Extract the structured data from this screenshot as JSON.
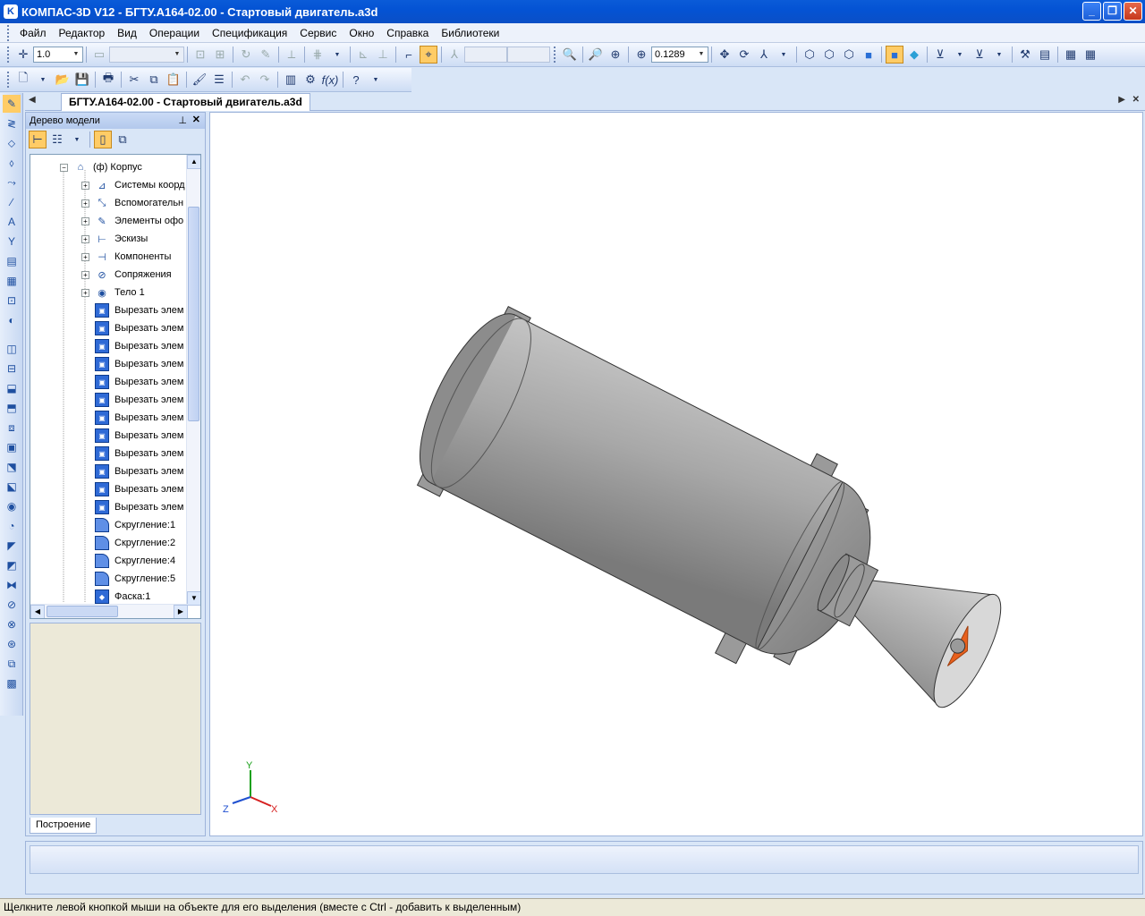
{
  "app": {
    "title": "КОМПАС-3D V12 - БГТУ.А164-02.00 - Стартовый двигатель.a3d",
    "logo": "K",
    "window_buttons": {
      "minimize": "_",
      "maximize": "❐",
      "close": "✕"
    }
  },
  "menu": [
    "Файл",
    "Редактор",
    "Вид",
    "Операции",
    "Спецификация",
    "Сервис",
    "Окно",
    "Справка",
    "Библиотеки"
  ],
  "toolbar": {
    "step_value": "1.0",
    "zoom_value": "0.1289"
  },
  "doc_tab": {
    "title": "БГТУ.А164-02.00 - Стартовый двигатель.a3d"
  },
  "tree_panel": {
    "title": "Дерево модели",
    "bottom_tab": "Построение",
    "items": [
      {
        "label": "(ф) Корпус",
        "icon": "part-icon",
        "level": 0,
        "expander": "−"
      },
      {
        "label": "Системы коорд",
        "icon": "coordinate-system-icon",
        "level": 1,
        "expander": "+"
      },
      {
        "label": "Вспомогательн",
        "icon": "auxiliary-geometry-icon",
        "level": 1,
        "expander": "+"
      },
      {
        "label": "Элементы офо",
        "icon": "design-elements-icon",
        "level": 1,
        "expander": "+"
      },
      {
        "label": "Эскизы",
        "icon": "sketch-icon",
        "level": 1,
        "expander": "+"
      },
      {
        "label": "Компоненты",
        "icon": "components-icon",
        "level": 1,
        "expander": "+"
      },
      {
        "label": "Сопряжения",
        "icon": "mates-icon",
        "level": 1,
        "expander": "+"
      },
      {
        "label": "Тело 1",
        "icon": "body-icon",
        "level": 1,
        "expander": "+"
      },
      {
        "label": "Вырезать элем",
        "icon": "cut-element-icon",
        "level": 1,
        "expander": ""
      },
      {
        "label": "Вырезать элем",
        "icon": "cut-element-icon",
        "level": 1,
        "expander": ""
      },
      {
        "label": "Вырезать элем",
        "icon": "cut-element-icon",
        "level": 1,
        "expander": ""
      },
      {
        "label": "Вырезать элем",
        "icon": "cut-element-icon",
        "level": 1,
        "expander": ""
      },
      {
        "label": "Вырезать элем",
        "icon": "cut-element-icon",
        "level": 1,
        "expander": ""
      },
      {
        "label": "Вырезать элем",
        "icon": "cut-element-icon",
        "level": 1,
        "expander": ""
      },
      {
        "label": "Вырезать элем",
        "icon": "cut-element-icon",
        "level": 1,
        "expander": ""
      },
      {
        "label": "Вырезать элем",
        "icon": "cut-element-icon",
        "level": 1,
        "expander": ""
      },
      {
        "label": "Вырезать элем",
        "icon": "cut-element-icon",
        "level": 1,
        "expander": ""
      },
      {
        "label": "Вырезать элем",
        "icon": "cut-element-icon",
        "level": 1,
        "expander": ""
      },
      {
        "label": "Вырезать элем",
        "icon": "cut-element-icon",
        "level": 1,
        "expander": ""
      },
      {
        "label": "Вырезать элем",
        "icon": "cut-element-icon",
        "level": 1,
        "expander": ""
      },
      {
        "label": "Скругление:1",
        "icon": "fillet-icon",
        "level": 1,
        "expander": ""
      },
      {
        "label": "Скругление:2",
        "icon": "fillet-icon",
        "level": 1,
        "expander": ""
      },
      {
        "label": "Скругление:4",
        "icon": "fillet-icon",
        "level": 1,
        "expander": ""
      },
      {
        "label": "Скругление:5",
        "icon": "fillet-icon",
        "level": 1,
        "expander": ""
      },
      {
        "label": "Фаска:1",
        "icon": "chamfer-icon",
        "level": 1,
        "expander": ""
      }
    ]
  },
  "viewport": {
    "axis_labels": {
      "x": "X",
      "y": "Y",
      "z": "Z"
    },
    "colors": {
      "body": "#a9a9a9",
      "nozzle_inner": "#e8601c",
      "axis_x": "#d62020",
      "axis_y": "#1aa01a",
      "axis_z": "#2050d0"
    }
  },
  "status_bar": {
    "hint": "Щелкните левой кнопкой мыши на объекте для его выделения (вместе с Ctrl - добавить к выделенным)"
  }
}
